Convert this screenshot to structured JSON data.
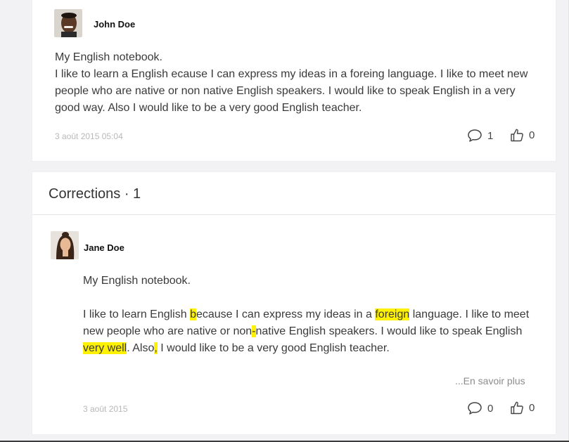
{
  "post": {
    "author": "John Doe",
    "lines": [
      "My English notebook.",
      "I like to learn a English ecause I can express my ideas in a foreing language. I like to meet new",
      "people who are native or non native English speakers. I would like to speak English in a very",
      "good way. Also I would like to be a very good English teacher."
    ],
    "date": "3 août 2015 05:04",
    "comment_count": "1",
    "like_count": "0"
  },
  "corrections": {
    "title": "Corrections · 1",
    "author": "Jane Doe",
    "line1": "My English notebook.",
    "p1": "I like to learn English ",
    "h1": "b",
    "p2": "ecause I can express my ideas in a ",
    "h2": "foreign",
    "p3": " language. I like to meet",
    "p4": "new people who are native or non",
    "h3": "-",
    "p5": "native English speakers. I would like to speak English",
    "h4": "very well",
    "p6": ". Also",
    "h5": ",",
    "p7": " I would like to be a very good English teacher.",
    "read_more": "...En savoir plus",
    "date": "3 août 2015",
    "comment_count": "0",
    "like_count": "0"
  },
  "icons": {
    "comment": "comment-bubble-icon",
    "like": "thumbs-up-icon"
  },
  "colors": {
    "highlight": "#fff200",
    "page_bg": "#f2f2f5"
  }
}
